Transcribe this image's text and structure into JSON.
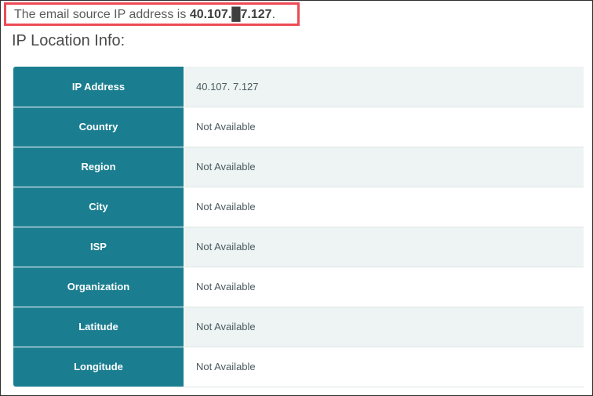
{
  "header": {
    "prefix": "The email source IP address is ",
    "ip": "40.107.█7.127",
    "suffix": "."
  },
  "section_title": "IP Location Info:",
  "table": {
    "rows": [
      {
        "label": "IP Address",
        "value": "40.107.  7.127"
      },
      {
        "label": "Country",
        "value": "Not Available"
      },
      {
        "label": "Region",
        "value": "Not Available"
      },
      {
        "label": "City",
        "value": "Not Available"
      },
      {
        "label": "ISP",
        "value": "Not Available"
      },
      {
        "label": "Organization",
        "value": "Not Available"
      },
      {
        "label": "Latitude",
        "value": "Not Available"
      },
      {
        "label": "Longitude",
        "value": "Not Available"
      }
    ]
  },
  "colors": {
    "label_bg": "#1a7e90",
    "highlight_border": "#ec4b55",
    "stripe_bg": "#edf4f3"
  }
}
